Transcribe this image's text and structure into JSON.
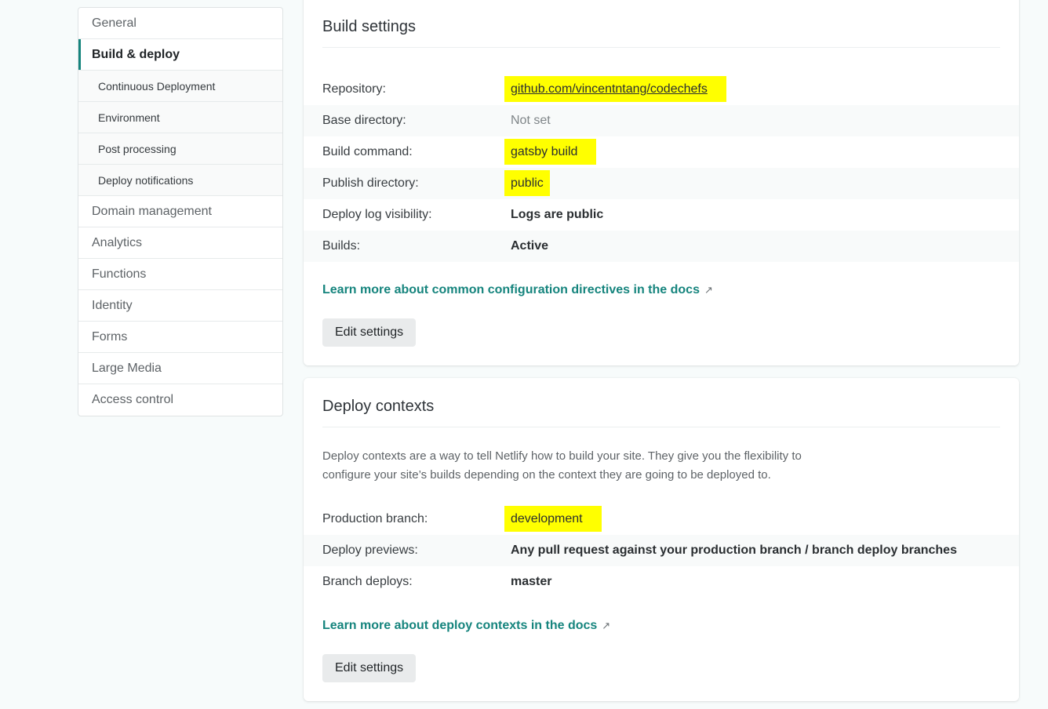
{
  "sidebar": {
    "items": [
      {
        "label": "General"
      },
      {
        "label": "Build & deploy"
      },
      {
        "label": "Continuous Deployment"
      },
      {
        "label": "Environment"
      },
      {
        "label": "Post processing"
      },
      {
        "label": "Deploy notifications"
      },
      {
        "label": "Domain management"
      },
      {
        "label": "Analytics"
      },
      {
        "label": "Functions"
      },
      {
        "label": "Identity"
      },
      {
        "label": "Forms"
      },
      {
        "label": "Large Media"
      },
      {
        "label": "Access control"
      }
    ]
  },
  "build_settings": {
    "title": "Build settings",
    "rows": [
      {
        "label": "Repository:",
        "value": "github.com/vincentntang/codechefs"
      },
      {
        "label": "Base directory:",
        "value": "Not set"
      },
      {
        "label": "Build command:",
        "value": "gatsby build"
      },
      {
        "label": "Publish directory:",
        "value": "public"
      },
      {
        "label": "Deploy log visibility:",
        "value": "Logs are public"
      },
      {
        "label": "Builds:",
        "value": "Active"
      }
    ],
    "docs_link": "Learn more about common configuration directives in the docs",
    "edit_button": "Edit settings"
  },
  "deploy_contexts": {
    "title": "Deploy contexts",
    "description_line1": "Deploy contexts are a way to tell Netlify how to build your site. They give you the flexibility to",
    "description_line2": "configure your site’s builds depending on the context they are going to be deployed to.",
    "rows": [
      {
        "label": "Production branch:",
        "value": "development"
      },
      {
        "label": "Deploy previews:",
        "value": "Any pull request against your production branch / branch deploy branches"
      },
      {
        "label": "Branch deploys:",
        "value": "master"
      }
    ],
    "docs_link": "Learn more about deploy contexts in the docs",
    "edit_button": "Edit settings"
  },
  "icons": {
    "external": "↗"
  },
  "colors": {
    "accent": "#15847d",
    "highlight": "#ffff00"
  }
}
